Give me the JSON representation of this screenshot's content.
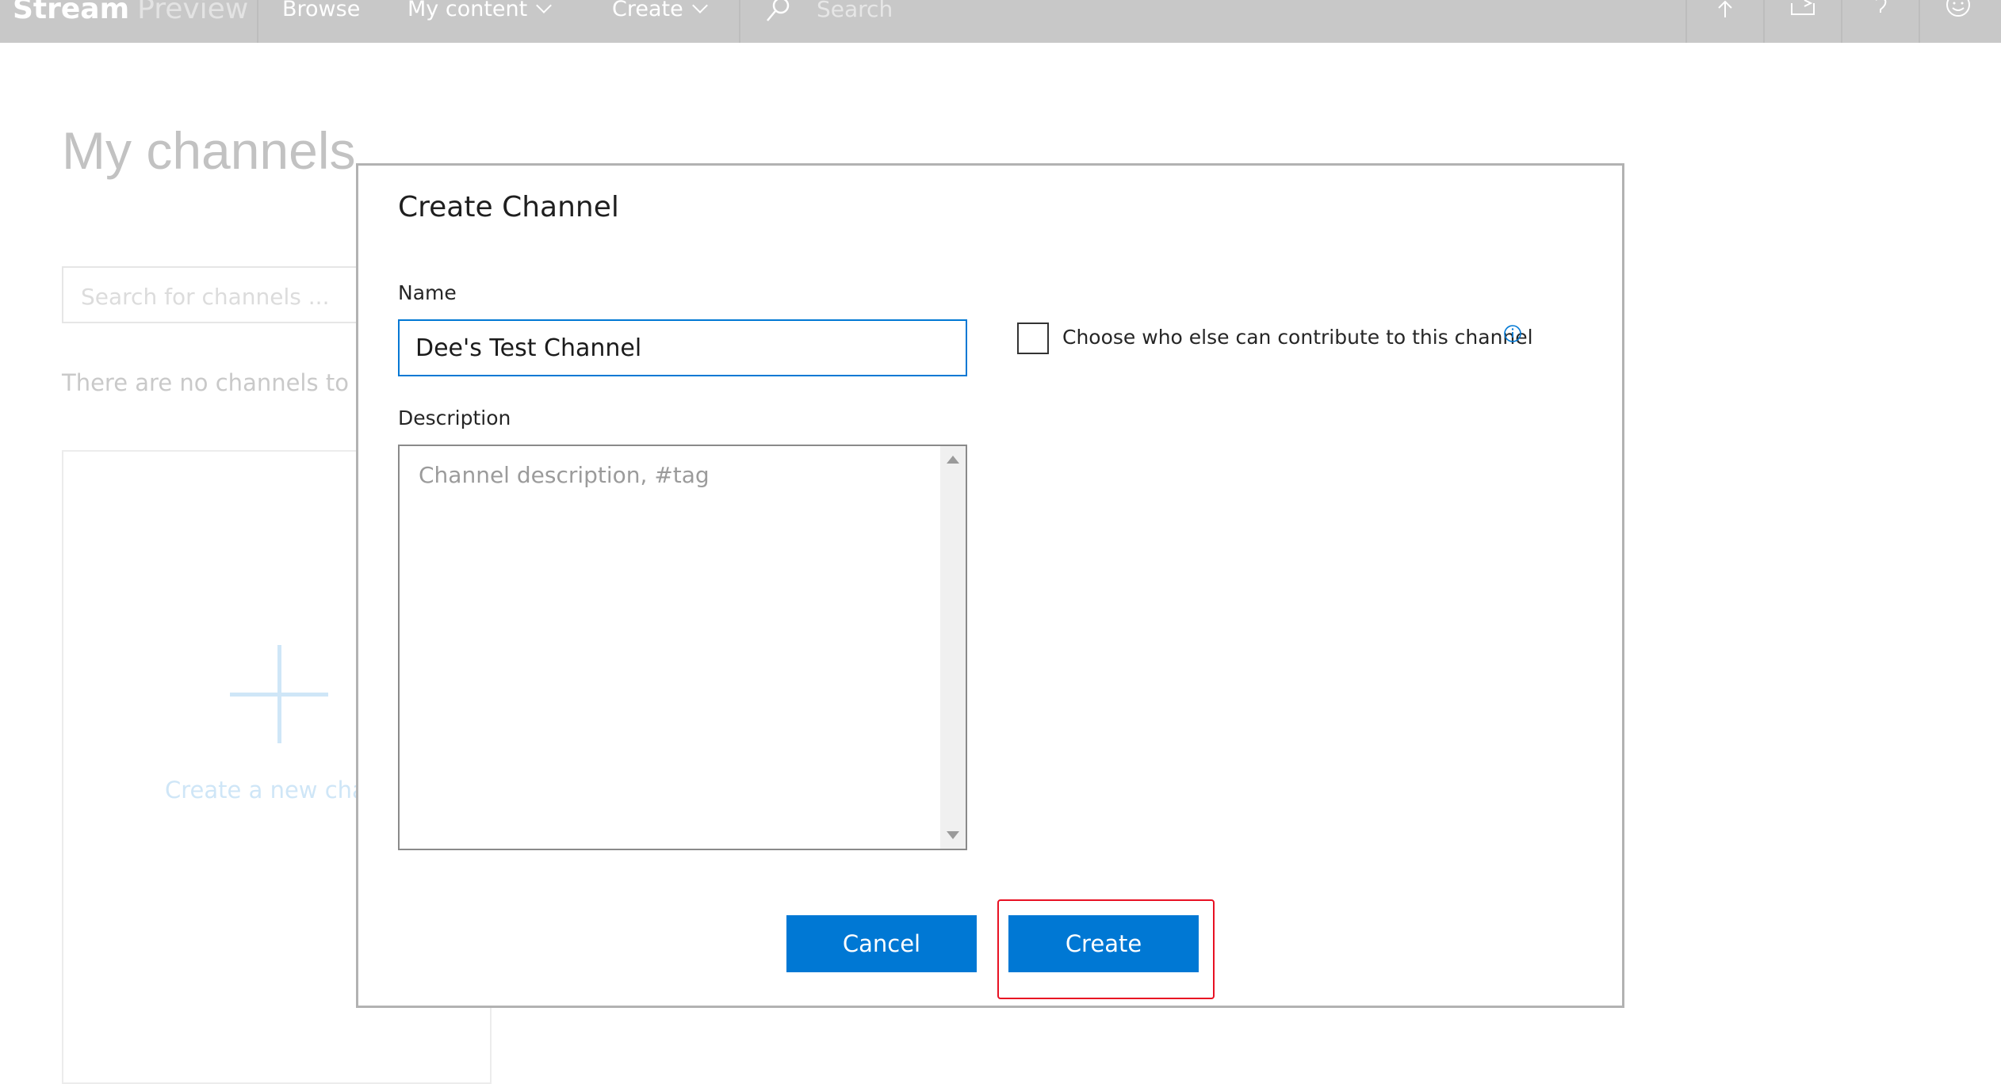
{
  "topbar": {
    "brand_name": "Stream",
    "brand_sub": "Preview",
    "nav_browse": "Browse",
    "nav_my_content": "My content",
    "nav_create": "Create",
    "search_placeholder": "Search",
    "icons": [
      "upload-icon",
      "share-icon",
      "help-icon",
      "smiley-icon"
    ]
  },
  "page": {
    "title": "My channels",
    "search_placeholder": "Search for channels ...",
    "empty_message": "There are no channels to display",
    "new_channel_label": "Create a new channel"
  },
  "dialog": {
    "title": "Create Channel",
    "name_label": "Name",
    "name_value": "Dee's Test Channel",
    "description_label": "Description",
    "description_placeholder": "Channel description, #tag",
    "contributors_label": "Choose who else can contribute to this channel",
    "cancel_label": "Cancel",
    "create_label": "Create"
  },
  "colors": {
    "accent": "#0078d4",
    "highlight": "#e81123",
    "overlay_text": "#c2c2c2"
  }
}
